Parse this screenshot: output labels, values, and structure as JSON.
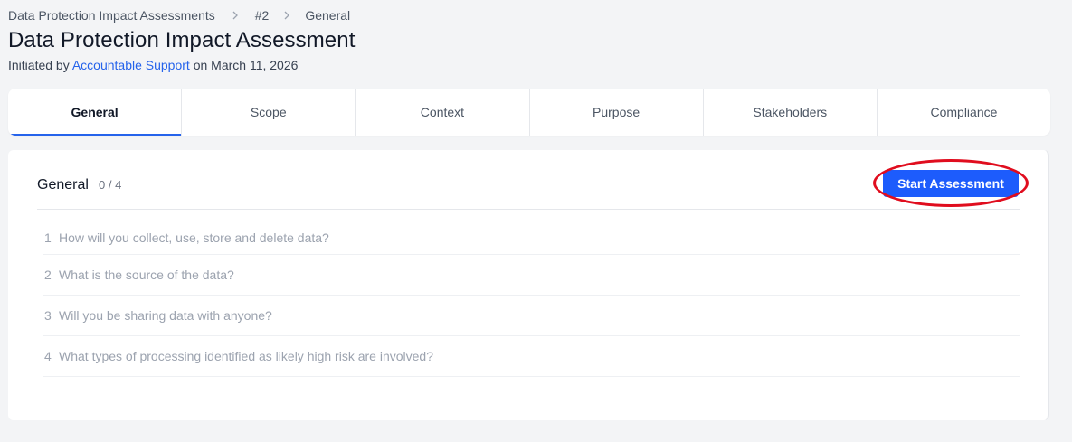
{
  "breadcrumb": {
    "items": [
      "Data Protection Impact Assessments",
      "#2",
      "General"
    ]
  },
  "header": {
    "title": "Data Protection Impact Assessment",
    "subtitle_prefix": "Initiated by ",
    "initiator": "Accountable Support",
    "subtitle_suffix": " on March 11, 2026"
  },
  "tabs": [
    {
      "label": "General",
      "active": true
    },
    {
      "label": "Scope",
      "active": false
    },
    {
      "label": "Context",
      "active": false
    },
    {
      "label": "Purpose",
      "active": false
    },
    {
      "label": "Stakeholders",
      "active": false
    },
    {
      "label": "Compliance",
      "active": false
    }
  ],
  "section": {
    "title": "General",
    "progress": "0 / 4",
    "start_button_label": "Start Assessment",
    "questions": [
      {
        "number": "1",
        "text": "How will you collect, use, store and delete data?"
      },
      {
        "number": "2",
        "text": "What is the source of the data?"
      },
      {
        "number": "3",
        "text": "Will you be sharing data with anyone?"
      },
      {
        "number": "4",
        "text": "What types of processing identified as likely high risk are involved?"
      }
    ]
  },
  "colors": {
    "accent": "#2563eb",
    "button": "#1d5cfc",
    "highlight_ring": "#e00d1e",
    "background": "#f3f4f6"
  },
  "icons": {
    "breadcrumb_separator": "chevron-right-icon"
  }
}
